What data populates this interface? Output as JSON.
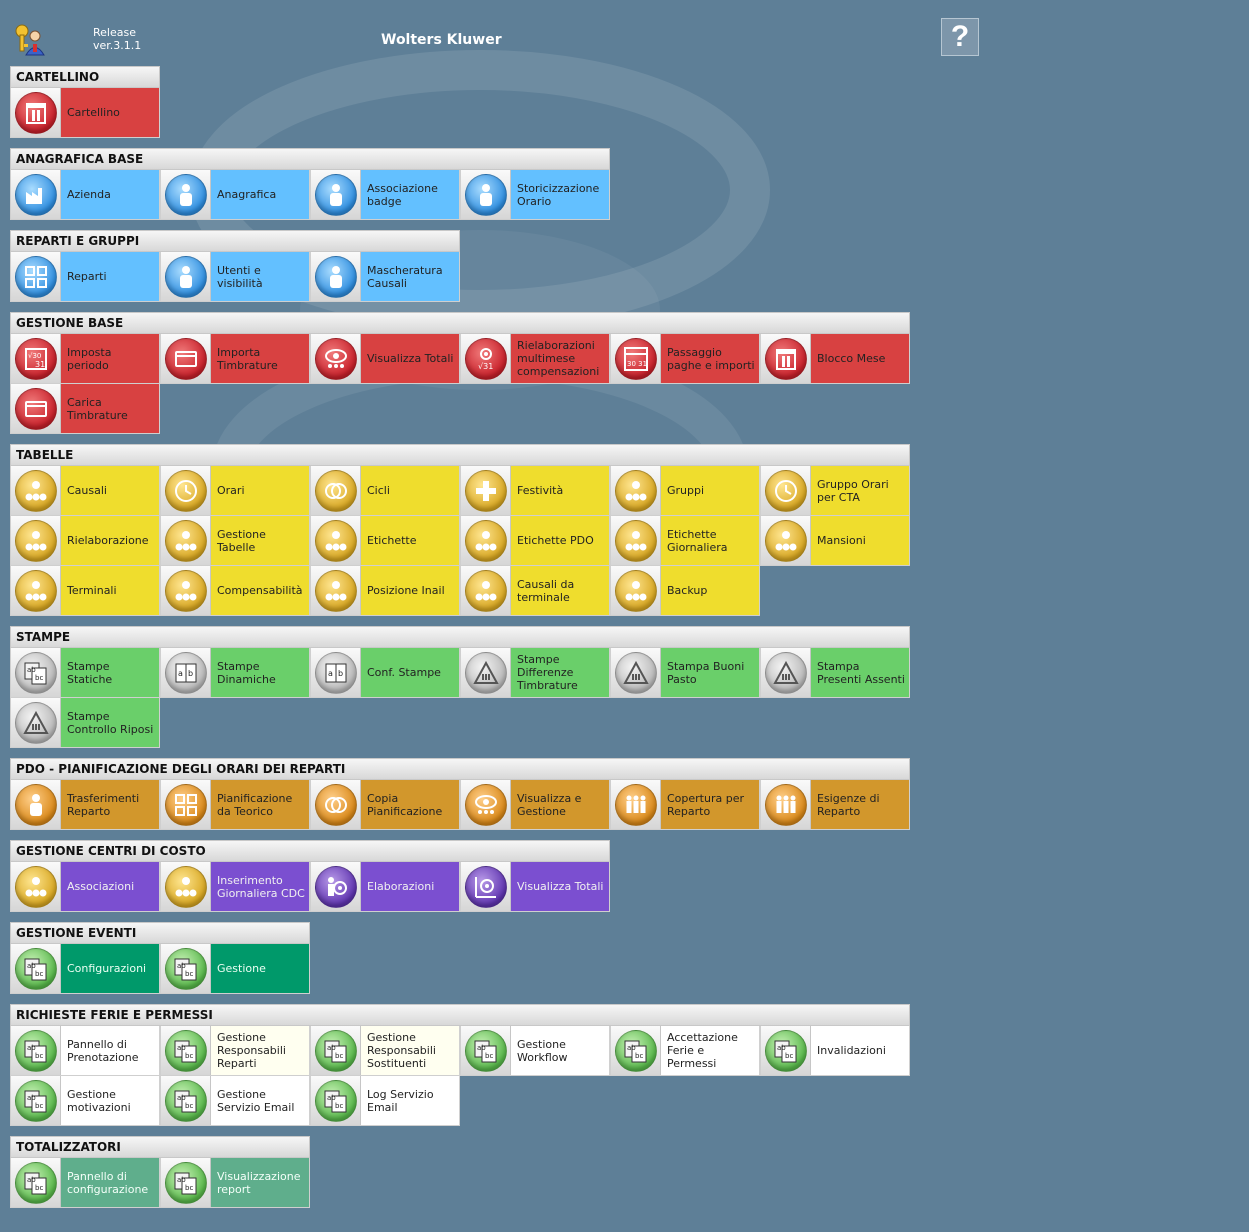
{
  "header": {
    "release_line1": "Release",
    "release_line2": "ver.3.1.1",
    "brand": "Wolters Kluwer",
    "help_label": "?"
  },
  "sections": [
    {
      "title": "CARTELLINO",
      "tiles": [
        {
          "label": "Cartellino",
          "icon": "calendar-icon"
        }
      ]
    },
    {
      "title": "ANAGRAFICA BASE",
      "tiles": [
        {
          "label": "Azienda",
          "icon": "factory-icon"
        },
        {
          "label": "Anagrafica",
          "icon": "person-icon"
        },
        {
          "label": "Associazione badge",
          "icon": "person-icon"
        },
        {
          "label": "Storicizzazione Orario",
          "icon": "person-icon"
        }
      ]
    },
    {
      "title": "REPARTI E GRUPPI",
      "tiles": [
        {
          "label": "Reparti",
          "icon": "grid-icon"
        },
        {
          "label": "Utenti e visibilità",
          "icon": "person-icon"
        },
        {
          "label": "Mascheratura Causali",
          "icon": "person-icon"
        }
      ]
    },
    {
      "title": "GESTIONE BASE",
      "tiles": [
        {
          "label": "Imposta periodo",
          "icon": "calendar-formula-icon"
        },
        {
          "label": "Importa Timbrature",
          "icon": "card-icon"
        },
        {
          "label": "Visualizza Totali",
          "icon": "eye-icon"
        },
        {
          "label": "Rielaborazioni multimese compensazioni",
          "icon": "gear-formula-icon"
        },
        {
          "label": "Passaggio paghe e importi",
          "icon": "calendar-grid-icon"
        },
        {
          "label": "Blocco Mese",
          "icon": "calendar-icon"
        },
        {
          "label": "Carica Timbrature",
          "icon": "card-icon"
        }
      ]
    },
    {
      "title": "TABELLE",
      "tiles": [
        {
          "label": "Causali",
          "icon": "group-icon"
        },
        {
          "label": "Orari",
          "icon": "clock-icon"
        },
        {
          "label": "Cicli",
          "icon": "cycle-icon"
        },
        {
          "label": "Festività",
          "icon": "cross-icon"
        },
        {
          "label": "Gruppi",
          "icon": "group-icon"
        },
        {
          "label": "Gruppo Orari per CTA",
          "icon": "clock-icon"
        },
        {
          "label": "Rielaborazione",
          "icon": "group-icon"
        },
        {
          "label": "Gestione Tabelle",
          "icon": "group-icon"
        },
        {
          "label": "Etichette",
          "icon": "group-icon"
        },
        {
          "label": "Etichette PDO",
          "icon": "group-icon"
        },
        {
          "label": "Etichette Giornaliera",
          "icon": "group-icon"
        },
        {
          "label": "Mansioni",
          "icon": "group-icon"
        },
        {
          "label": "Terminali",
          "icon": "group-icon"
        },
        {
          "label": "Compensabilità",
          "icon": "group-icon"
        },
        {
          "label": "Posizione Inail",
          "icon": "group-icon"
        },
        {
          "label": "Causali da terminale",
          "icon": "group-icon"
        },
        {
          "label": "Backup",
          "icon": "group-icon"
        }
      ]
    },
    {
      "title": "STAMPE",
      "tiles": [
        {
          "label": "Stampe Statiche",
          "icon": "abc-icon"
        },
        {
          "label": "Stampe Dinamiche",
          "icon": "ab-icon"
        },
        {
          "label": "Conf. Stampe",
          "icon": "ab-icon"
        },
        {
          "label": "Stampe Differenze Timbrature",
          "icon": "triangle-icon"
        },
        {
          "label": "Stampa Buoni Pasto",
          "icon": "triangle-icon"
        },
        {
          "label": "Stampa Presenti Assenti",
          "icon": "triangle-icon"
        },
        {
          "label": "Stampe Controllo Riposi",
          "icon": "triangle-icon"
        }
      ]
    },
    {
      "title": "PDO - PIANIFICAZIONE DEGLI ORARI DEI REPARTI",
      "tiles": [
        {
          "label": "Trasferimenti Reparto",
          "icon": "person-icon"
        },
        {
          "label": "Pianificazione da Teorico",
          "icon": "grid-icon"
        },
        {
          "label": "Copia Pianificazione",
          "icon": "rings-icon"
        },
        {
          "label": "Visualizza e Gestione",
          "icon": "eye-icon"
        },
        {
          "label": "Copertura per Reparto",
          "icon": "people-icon"
        },
        {
          "label": "Esigenze di Reparto",
          "icon": "people-icon"
        }
      ]
    },
    {
      "title": "GESTIONE CENTRI DI COSTO",
      "tiles": [
        {
          "label": "Associazioni",
          "icon": "group-icon"
        },
        {
          "label": "Inserimento Giornaliera CDC",
          "icon": "group-icon"
        },
        {
          "label": "Elaborazioni",
          "icon": "gear-person-icon"
        },
        {
          "label": "Visualizza Totali",
          "icon": "gear-chart-icon"
        }
      ]
    },
    {
      "title": "GESTIONE EVENTI",
      "tiles": [
        {
          "label": "Configurazioni",
          "icon": "abc-icon"
        },
        {
          "label": "Gestione",
          "icon": "abc-icon"
        }
      ]
    },
    {
      "title": "RICHIESTE FERIE E PERMESSI",
      "tiles": [
        {
          "label": "Pannello di Prenotazione",
          "icon": "abc-icon"
        },
        {
          "label": "Gestione Responsabili Reparti",
          "icon": "abc-icon"
        },
        {
          "label": "Gestione Responsabili Sostituenti",
          "icon": "abc-icon"
        },
        {
          "label": "Gestione Workflow",
          "icon": "abc-icon"
        },
        {
          "label": "Accettazione Ferie e Permessi",
          "icon": "abc-icon"
        },
        {
          "label": "Invalidazioni",
          "icon": "abc-icon"
        },
        {
          "label": "Gestione motivazioni",
          "icon": "abc-icon"
        },
        {
          "label": "Gestione Servizio Email",
          "icon": "abc-icon"
        },
        {
          "label": "Log Servizio Email",
          "icon": "abc-icon"
        }
      ]
    },
    {
      "title": "TOTALIZZATORI",
      "tiles": [
        {
          "label": "Pannello di configurazione",
          "icon": "abc-icon"
        },
        {
          "label": "Visualizzazione report",
          "icon": "abc-icon"
        }
      ]
    }
  ],
  "colors": {
    "background": "#5e7f97",
    "red": "#d84141",
    "blue": "#63c0ff",
    "yellow": "#efdd2d",
    "green": "#6acf6a",
    "orange": "#d2972c",
    "purple": "#7b4fd0",
    "dark_green": "#00996a",
    "teal": "#5fae8c",
    "white": "#ffffff"
  }
}
